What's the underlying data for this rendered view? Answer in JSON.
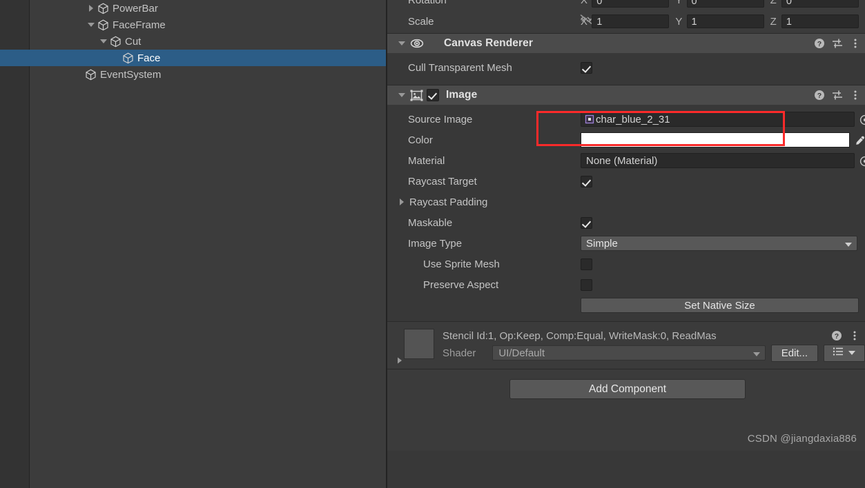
{
  "hierarchy": {
    "name": "hierarchy-panel",
    "items": [
      {
        "label": "PowerBar",
        "indent": 3,
        "foldout": "closed",
        "selected": false,
        "icon": "cube-icon"
      },
      {
        "label": "FaceFrame",
        "indent": 3,
        "foldout": "open",
        "selected": false,
        "icon": "cube-icon"
      },
      {
        "label": "Cut",
        "indent": 4,
        "foldout": "open",
        "selected": false,
        "icon": "cube-icon"
      },
      {
        "label": "Face",
        "indent": 5,
        "foldout": "none",
        "selected": true,
        "icon": "cube-icon"
      },
      {
        "label": "EventSystem",
        "indent": 2,
        "foldout": "none",
        "selected": false,
        "icon": "cube-icon"
      }
    ]
  },
  "inspector": {
    "transform": {
      "rows": [
        {
          "label": "Rotation",
          "axes": [
            {
              "axis": "X",
              "value": "0"
            },
            {
              "axis": "Y",
              "value": "0"
            },
            {
              "axis": "Z",
              "value": "0"
            }
          ],
          "constrain_icon": ""
        },
        {
          "label": "Scale",
          "axes": [
            {
              "axis": "X",
              "value": "1"
            },
            {
              "axis": "Y",
              "value": "1"
            },
            {
              "axis": "Z",
              "value": "1"
            }
          ],
          "constrain_icon": "constrain-proportions-off-icon"
        }
      ]
    },
    "canvas_renderer": {
      "title": "Canvas Renderer",
      "icon": "eye-icon",
      "foldout": "open",
      "help_icon": "help-icon",
      "preset_icon": "preset-settings-icon",
      "menu_icon": "more-menu-icon",
      "properties": [
        {
          "label": "Cull Transparent Mesh",
          "type": "checkbox",
          "checked": true
        }
      ]
    },
    "image": {
      "title": "Image",
      "icon": "image-component-icon",
      "foldout": "open",
      "enabled": true,
      "help_icon": "help-icon",
      "preset_icon": "preset-settings-icon",
      "menu_icon": "more-menu-icon",
      "source_image": {
        "label": "Source Image",
        "value": "char_blue_2_31",
        "icon": "sprite-icon",
        "picker_icon": "object-picker-icon",
        "highlighted": true
      },
      "color": {
        "label": "Color",
        "value": "#FFFFFF",
        "eyedropper_icon": "eyedropper-icon"
      },
      "material": {
        "label": "Material",
        "value": "None (Material)",
        "picker_icon": "object-picker-icon"
      },
      "raycast_target": {
        "label": "Raycast Target",
        "checked": true
      },
      "raycast_padding": {
        "label": "Raycast Padding",
        "foldout": "closed"
      },
      "maskable": {
        "label": "Maskable",
        "checked": true
      },
      "image_type": {
        "label": "Image Type",
        "value": "Simple",
        "arrow_icon": "chevron-down-icon"
      },
      "use_sprite_mesh": {
        "label": "Use Sprite Mesh",
        "checked": false
      },
      "preserve_aspect": {
        "label": "Preserve Aspect",
        "checked": false
      },
      "set_native_size": {
        "label": "Set Native Size"
      }
    },
    "material_block": {
      "title": "Stencil Id:1, Op:Keep, Comp:Equal, WriteMask:0, ReadMas",
      "preview_icon": "material-preview-swatch",
      "foldout": "closed",
      "help_icon": "help-icon",
      "menu_icon": "more-menu-icon",
      "shader_label": "Shader",
      "shader_value": "UI/Default",
      "edit_label": "Edit...",
      "list_icon": "shader-list-icon",
      "list_arrow_icon": "chevron-down-icon"
    },
    "add_component": {
      "label": "Add Component"
    },
    "watermark": "CSDN @jiangdaxia886"
  },
  "colors": {
    "panel_bg": "#383838",
    "hierarchy_bg": "#3c3c3c",
    "header_bg": "#4b4b4b",
    "selection_blue": "#2c5d87",
    "field_bg": "#2a2a2a",
    "button_bg": "#585858",
    "annotation_red": "#fc2a2a",
    "color_swatch": "#FFFFFF"
  }
}
